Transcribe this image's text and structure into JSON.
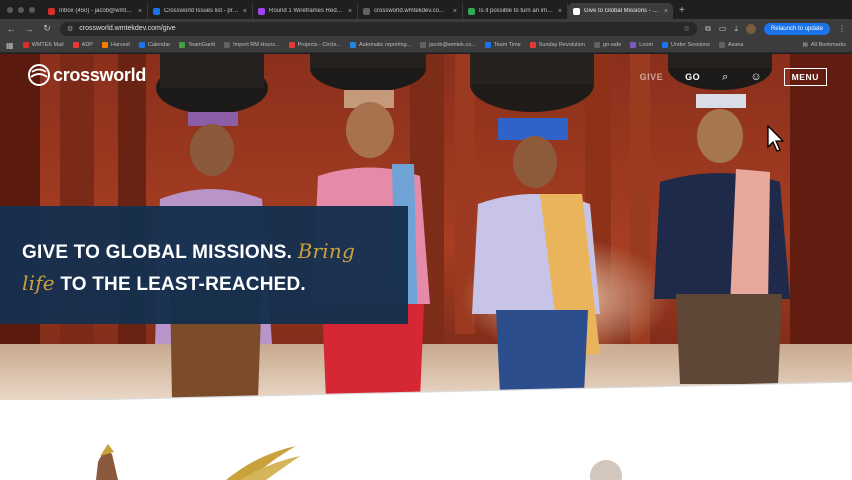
{
  "browser": {
    "tabs": [
      {
        "title": "Inbox (450) - jacob@wmtek...",
        "color": "#d93025",
        "active": false
      },
      {
        "title": "Crossworld Issues list - pro...",
        "color": "#1a73e8",
        "active": false
      },
      {
        "title": "Round 1 Wireframes Redesig...",
        "color": "#a142f4",
        "active": false
      },
      {
        "title": "crossworld.wmtekdev.com -...",
        "color": "#5f6368",
        "active": false
      },
      {
        "title": "Is it possible to turn an imag...",
        "color": "#34a853",
        "active": false
      },
      {
        "title": "Give to Global Missions - Cro...",
        "color": "#ffffff",
        "active": true
      }
    ],
    "new_tab": "+",
    "url": "crossworld.wmtekdev.com/give",
    "relaunch_label": "Relaunch to update",
    "bookmarks": [
      {
        "label": "WMTEK Mail",
        "color": "#d93025"
      },
      {
        "label": "ADP",
        "color": "#e53935"
      },
      {
        "label": "Harvest",
        "color": "#f57c00"
      },
      {
        "label": "Calendar",
        "color": "#1a73e8"
      },
      {
        "label": "TeamGantt",
        "color": "#43a047"
      },
      {
        "label": "Import RM Hours...",
        "color": "#5f6368"
      },
      {
        "label": "Projects - Circle...",
        "color": "#e53935"
      },
      {
        "label": "Automatic reporting...",
        "color": "#1e88e5"
      },
      {
        "label": "jacob@wmtek.co...",
        "color": "#5f6368"
      },
      {
        "label": "Team Time",
        "color": "#1a73e8"
      },
      {
        "label": "Sunday Revolution",
        "color": "#e53935"
      },
      {
        "label": "go-safe",
        "color": "#5f6368"
      },
      {
        "label": "Loom",
        "color": "#7e57c2"
      },
      {
        "label": "Under Sessions",
        "color": "#1a73e8"
      },
      {
        "label": "Asana",
        "color": "#5f6368"
      }
    ],
    "all_bookmarks": "All Bookmarks"
  },
  "site": {
    "logo_text": "crossworld",
    "nav": {
      "give": "GIVE",
      "go": "GO",
      "menu": "MENU"
    },
    "hero": {
      "headline_part1": "GIVE TO GLOBAL MISSIONS.",
      "script_bring": "Bring",
      "script_life": "life",
      "headline_part2": "TO THE LEAST-REACHED."
    }
  },
  "colors": {
    "banner": "#16304e",
    "accent_gold": "#c9a23b"
  }
}
